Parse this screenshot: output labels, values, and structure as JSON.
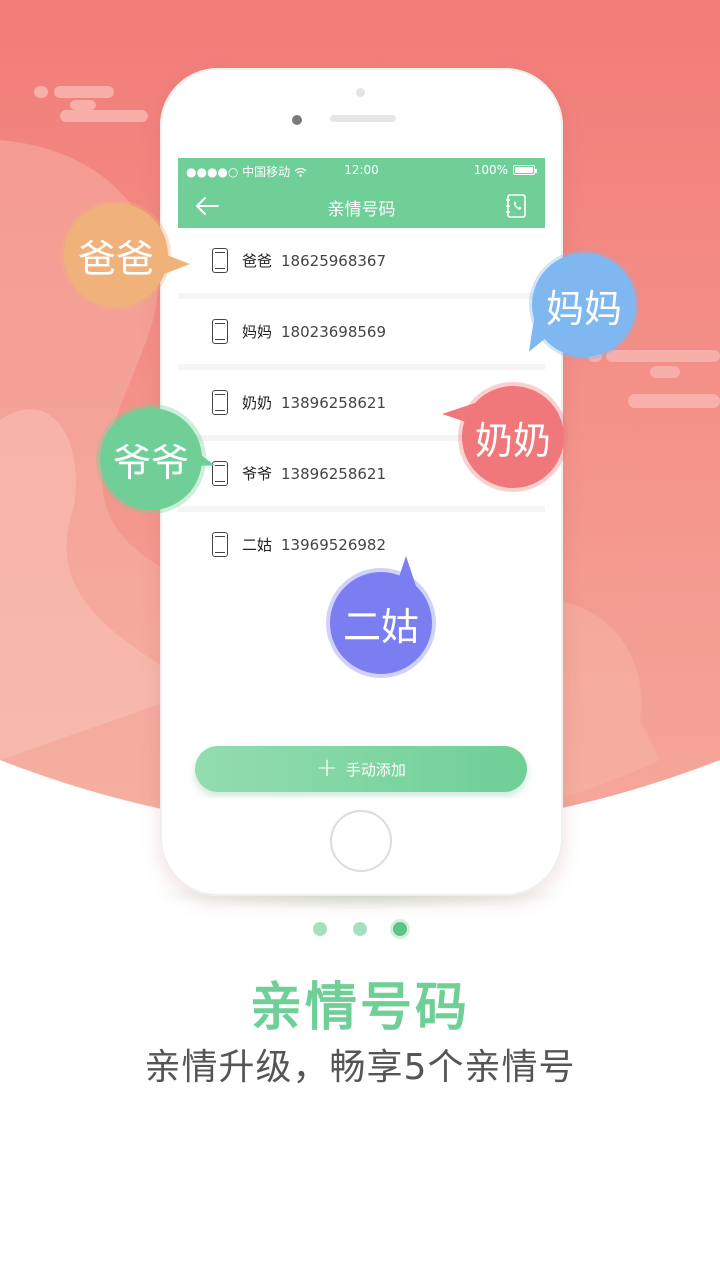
{
  "status_bar": {
    "carrier": "●●●●○ 中国移动",
    "time": "12:00",
    "battery": "100%"
  },
  "nav": {
    "title": "亲情号码"
  },
  "contacts": [
    {
      "name": "爸爸",
      "number": "18625968367"
    },
    {
      "name": "妈妈",
      "number": "18023698569"
    },
    {
      "name": "奶奶",
      "number": "13896258621"
    },
    {
      "name": "爷爷",
      "number": "13896258621"
    },
    {
      "name": "二姑",
      "number": "13969526982"
    }
  ],
  "add_button": {
    "plus": "+",
    "label": "手动添加"
  },
  "bubbles": {
    "dad": "爸爸",
    "mom": "妈妈",
    "grandpa": "爷爷",
    "grandma": "奶奶",
    "aunt": "二姑"
  },
  "pagination": {
    "total": 3,
    "active": 3
  },
  "headline": "亲情号码",
  "subline": "亲情升级，畅享5个亲情号",
  "colors": {
    "brand_green": "#6fcf97",
    "bg_coral": "#f2807b",
    "bubble_orange": "#f0b27a",
    "bubble_blue": "#7fb8f0",
    "bubble_green": "#6fcf97",
    "bubble_red": "#f0777a",
    "bubble_purple": "#7b7ef0"
  },
  "icons": {
    "back": "arrow-left-icon",
    "contacts_book": "address-book-icon",
    "row_phone": "mobile-phone-icon",
    "wifi": "wifi-icon",
    "battery": "battery-icon"
  }
}
